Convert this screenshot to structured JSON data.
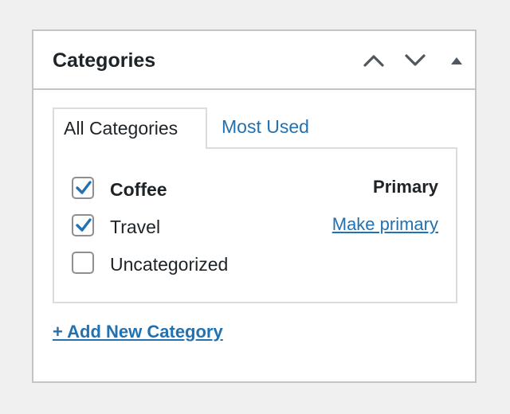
{
  "panel": {
    "title": "Categories",
    "controls": [
      "move-up",
      "move-down",
      "toggle-panel"
    ]
  },
  "tabs": [
    {
      "label": "All Categories",
      "active": true
    },
    {
      "label": "Most Used",
      "active": false
    }
  ],
  "categories": [
    {
      "label": "Coffee",
      "checked": true,
      "primary": true,
      "action": "Primary"
    },
    {
      "label": "Travel",
      "checked": true,
      "primary": false,
      "action": "Make primary"
    },
    {
      "label": "Uncategorized",
      "checked": false,
      "primary": false,
      "action": ""
    }
  ],
  "add_new_label": "+ Add New Category",
  "colors": {
    "accent": "#2271b1",
    "text": "#1d2327",
    "border": "#c3c4c7",
    "background": "#f0f0f1"
  },
  "icons": {
    "move_up": "chevron-up-icon",
    "move_down": "chevron-down-icon",
    "toggle": "triangle-up-icon",
    "checkmark": "checkmark-icon"
  }
}
